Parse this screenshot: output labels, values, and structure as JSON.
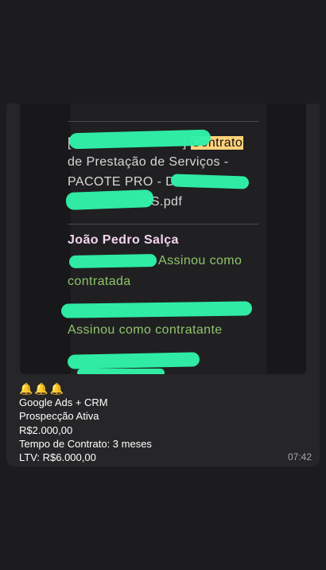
{
  "document_preview": {
    "filename_lines": [
      {
        "prefix": "[",
        "mid": "]",
        "highlight": "Contrato"
      },
      "de Prestação de Serviços -",
      "PACOTE PRO - D",
      "OS.pdf"
    ],
    "signer_name": "João Pedro Salça",
    "signed_as_contracted_line1": "Assinou como",
    "signed_as_contracted_line2": "contratada",
    "signed_as_contractor": "Assinou como contratante"
  },
  "message": {
    "bells": "🔔🔔🔔",
    "lines": [
      "Google Ads + CRM",
      "Prospecção Ativa",
      "R$2.000,00",
      "Tempo de Contrato: 3 meses",
      "LTV: R$6.000,00"
    ],
    "timestamp": "07:42"
  },
  "colors": {
    "background": "#1c1c1e",
    "bubble": "#262628",
    "highlight": "#ffd27a",
    "signer_name": "#f6d4f2",
    "signed_text": "#8fc46c",
    "redaction": "#2ff2a8"
  }
}
